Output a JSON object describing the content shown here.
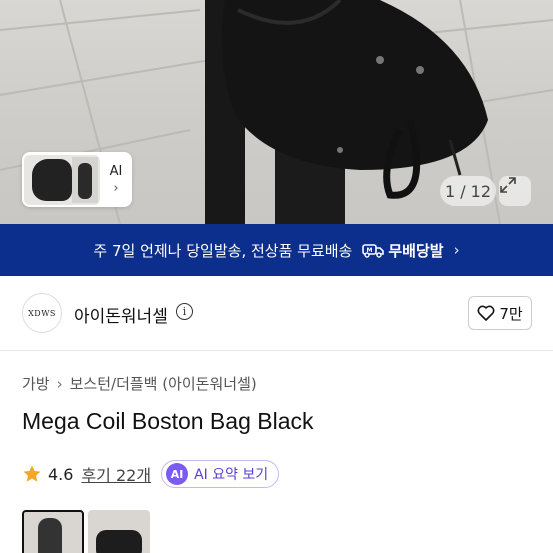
{
  "gallery": {
    "thumb_ai_label": "AI",
    "counter": "1 / 12"
  },
  "shipping": {
    "text": "주 7일 언제나 당일발송, 전상품 무료배송",
    "badge": "무배당발"
  },
  "shop": {
    "logo_text": "XDWS",
    "name": "아이돈워너셀",
    "likes": "7만"
  },
  "product": {
    "breadcrumb": [
      "가방",
      "보스턴/더플백 (아이돈워너셀)"
    ],
    "title": "Mega Coil Boston Bag Black",
    "rating": "4.6",
    "reviews": "후기 22개",
    "ai_summary": "AI 요약 보기",
    "ai_badge": "AI"
  },
  "colors": {
    "banner": "#0c2e8c",
    "star": "#f5a623",
    "ai_accent": "#7b5bf0"
  }
}
